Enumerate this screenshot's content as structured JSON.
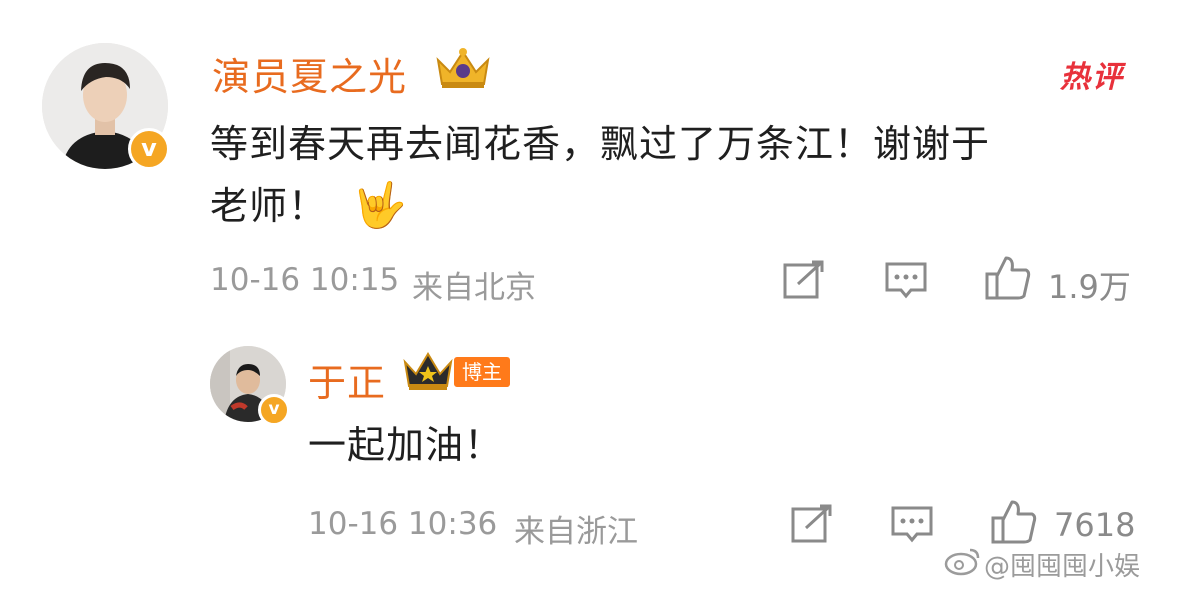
{
  "comment": {
    "author": "演员夏之光",
    "hot_label": "热评",
    "text_line1": "等到春天再去闻花香，飘过了万条江！谢谢于",
    "text_line2": "老师！",
    "emoji": "🤟",
    "timestamp": "10-16 10:15",
    "location": "来自北京",
    "like_count": "1.9万"
  },
  "reply": {
    "author": "于正",
    "badge": "博主",
    "text": "一起加油！",
    "timestamp": "10-16 10:36",
    "location": "来自浙江",
    "like_count": "7618"
  },
  "watermark": "@囤囤囤小娱",
  "verified_badge": "v",
  "colors": {
    "name": "#e86b1f",
    "hot": "#e8313b",
    "badge": "#f5a623",
    "meta": "#9a9a9a"
  }
}
